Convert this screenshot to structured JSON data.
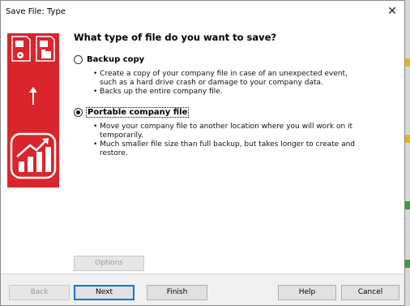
{
  "window": {
    "title": "Save File: Type",
    "close_glyph": "✕"
  },
  "panel": {
    "brand_color": "#d9252b",
    "icons": [
      "backup-file-icon",
      "portable-file-icon",
      "arrow-up-icon",
      "growth-chart-icon"
    ]
  },
  "heading": "What type of file do you want to save?",
  "options": [
    {
      "label": "Backup copy",
      "checked": false,
      "bullets": [
        "Create a copy of your company file in case of an unexpected event, such as a hard drive crash or damage to your company data.",
        "Backs up the entire company file."
      ]
    },
    {
      "label": "Portable company file",
      "checked": true,
      "bullets": [
        "Move your company file to another location where you will work on it temporarily.",
        "Much smaller file size than full backup, but takes longer to create and restore."
      ]
    }
  ],
  "buttons": {
    "options": "Options",
    "back": "Back",
    "next": "Next",
    "finish": "Finish",
    "help": "Help",
    "cancel": "Cancel"
  }
}
